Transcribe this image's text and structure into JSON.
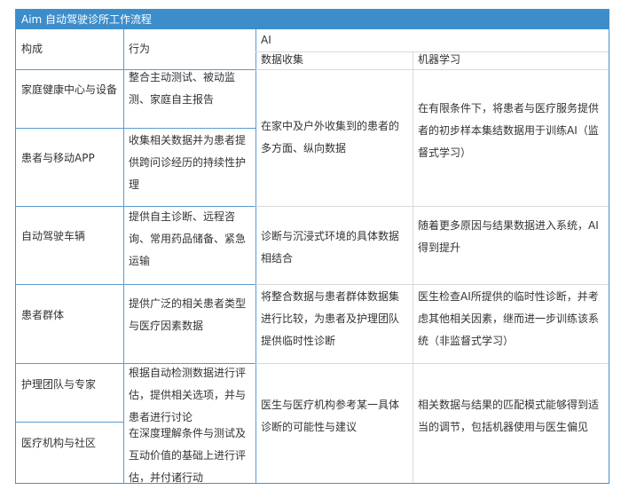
{
  "title": "Aim 自动驾驶诊所工作流程",
  "headers": {
    "col1": "构成",
    "col2": "行为",
    "ai": "AI",
    "ai_sub1": "数据收集",
    "ai_sub2": "机器学习"
  },
  "rows": [
    {
      "component": "家庭健康中心与设备",
      "behavior": [
        "整合主动测试、被动监",
        "测、家庭自主报告"
      ]
    },
    {
      "component": "患者与移动APP",
      "behavior": [
        "收集相关数据并为患者提",
        "供跨问诊经历的持续性护",
        "理"
      ]
    },
    {
      "component": "自动驾驶车辆",
      "behavior": [
        "提供自主诊断、远程咨",
        "询、常用药品储备、紧急",
        "运输"
      ]
    },
    {
      "component": "患者群体",
      "behavior": [
        "提供广泛的相关患者类型",
        "与医疗因素数据"
      ]
    },
    {
      "component": "护理团队与专家",
      "behavior": [
        "根据自动检测数据进行评",
        "估，提供相关选项，并与",
        "患者进行讨论"
      ]
    },
    {
      "component": "医疗机构与社区",
      "behavior": [
        "在深度理解条件与测试及",
        "互动价值的基础上进行评",
        "估，并付诸行动"
      ]
    }
  ],
  "ai_cells": [
    {
      "data_collection": [
        "在家中及户外收集到的患者的",
        "多方面、纵向数据"
      ],
      "machine_learning": [
        "在有限条件下，将患者与医疗服务提供",
        "者的初步样本集结数据用于训练AI（监",
        "督式学习）"
      ]
    },
    {
      "data_collection": [
        "诊断与沉浸式环境的具体数据",
        "相结合"
      ],
      "machine_learning": [
        "随着更多原因与结果数据进入系统，AI",
        "得到提升"
      ]
    },
    {
      "data_collection": [
        "将整合数据与患者群体数据集",
        "进行比较，为患者及护理团队",
        "提供临时性诊断"
      ],
      "machine_learning": [
        "医生检查AI所提供的临时性诊断，并考",
        "虑其他相关因素，继而进一步训练该系",
        "统（非监督式学习）"
      ]
    },
    {
      "data_collection": [
        "医生与医疗机构参考某一具体",
        "诊断的可能性与建议"
      ],
      "machine_learning": [
        "相关数据与结果的匹配模式能够得到适",
        "当的调节，包括机器使用与医生偏见"
      ]
    }
  ]
}
